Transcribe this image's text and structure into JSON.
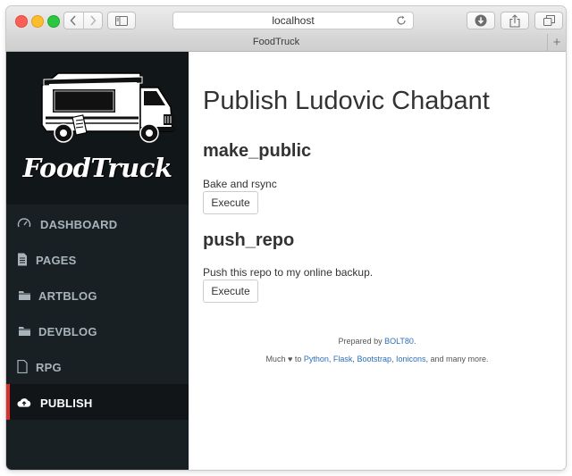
{
  "browser": {
    "url": "localhost",
    "tab_title": "FoodTruck",
    "new_tab_label": "+"
  },
  "sidebar": {
    "logo_text": "FoodTruck",
    "items": [
      {
        "label": "DASHBOARD",
        "icon": "speedometer-icon",
        "active": false
      },
      {
        "label": "PAGES",
        "icon": "document-icon",
        "active": false
      },
      {
        "label": "ARTBLOG",
        "icon": "folder-icon",
        "active": false
      },
      {
        "label": "DEVBLOG",
        "icon": "folder-icon",
        "active": false
      },
      {
        "label": "RPG",
        "icon": "document-outline-icon",
        "active": false
      },
      {
        "label": "PUBLISH",
        "icon": "cloud-upload-icon",
        "active": true
      }
    ]
  },
  "main": {
    "title": "Publish Ludovic Chabant",
    "targets": [
      {
        "name": "make_public",
        "description": "Bake and rsync",
        "button": "Execute"
      },
      {
        "name": "push_repo",
        "description": "Push this repo to my online backup.",
        "button": "Execute"
      }
    ]
  },
  "footer": {
    "prepared_prefix": "Prepared by ",
    "prepared_link": "BOLT80",
    "prepared_suffix": ".",
    "much": "Much",
    "to": "to",
    "link_python": "Python",
    "link_flask": "Flask",
    "link_bootstrap": "Bootstrap",
    "link_ionicons": "Ionicons",
    "more": ", and many more.",
    "heart": "♥",
    "sep": ", ",
    "link_color": "#2a6ebb"
  },
  "colors": {
    "sidebar_bg": "#182024",
    "logo_bg": "#111618",
    "active_accent": "#d9322e"
  }
}
